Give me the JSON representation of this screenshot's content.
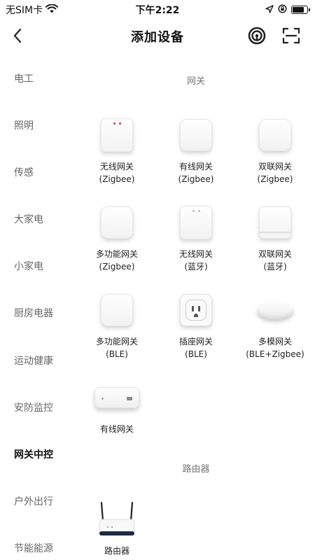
{
  "status_bar": {
    "carrier": "无SIM卡",
    "time": "下午2:22",
    "battery_level": 0.85
  },
  "nav": {
    "title": "添加设备",
    "back_icon": "chevron-left-icon",
    "nfc_icon": "nfc-icon",
    "scan_icon": "scan-icon"
  },
  "sidebar": {
    "items": [
      {
        "label": "电工",
        "active": false
      },
      {
        "label": "照明",
        "active": false
      },
      {
        "label": "传感",
        "active": false
      },
      {
        "label": "大家电",
        "active": false
      },
      {
        "label": "小家电",
        "active": false
      },
      {
        "label": "厨房电器",
        "active": false
      },
      {
        "label": "运动健康",
        "active": false
      },
      {
        "label": "安防监控",
        "active": false
      },
      {
        "label": "网关中控",
        "active": true
      },
      {
        "label": "户外出行",
        "active": false
      },
      {
        "label": "节能能源",
        "active": false
      }
    ]
  },
  "sections": [
    {
      "title": "网关",
      "devices": [
        {
          "name": "无线网关",
          "sub": "(Zigbee)"
        },
        {
          "name": "有线网关",
          "sub": "(Zigbee)"
        },
        {
          "name": "双联网关",
          "sub": "(Zigbee)"
        },
        {
          "name": "多功能网关",
          "sub": "(Zigbee)"
        },
        {
          "name": "无线网关",
          "sub": "(蓝牙)"
        },
        {
          "name": "双联网关",
          "sub": "(蓝牙)"
        },
        {
          "name": "多功能网关",
          "sub": "(BLE)"
        },
        {
          "name": "插座网关",
          "sub": "(BLE)"
        },
        {
          "name": "多模网关",
          "sub": "(BLE+Zigbee)"
        },
        {
          "name": "有线网关",
          "sub": ""
        }
      ]
    },
    {
      "title": "路由器",
      "devices": [
        {
          "name": "路由器",
          "sub": ""
        }
      ]
    }
  ]
}
